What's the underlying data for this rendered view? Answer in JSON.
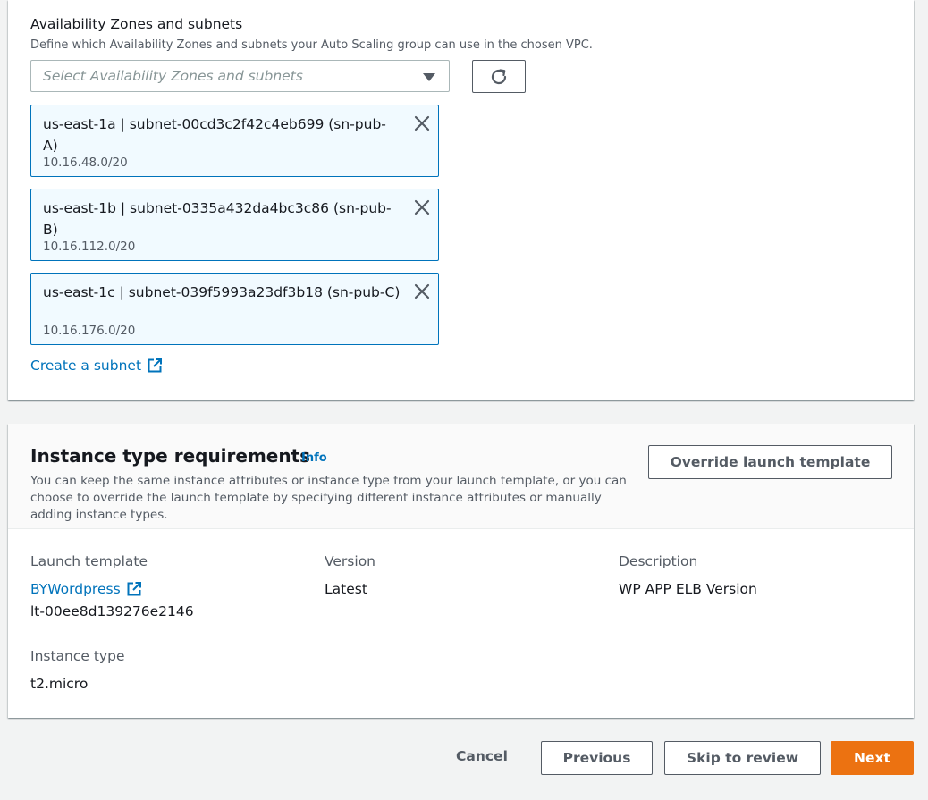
{
  "subnets_section": {
    "label": "Availability Zones and subnets",
    "description": "Define which Availability Zones and subnets your Auto Scaling group can use in the chosen VPC.",
    "select_placeholder": "Select Availability Zones and subnets",
    "tokens": [
      {
        "title": "us-east-1a | subnet-00cd3c2f42c4eb699 (sn-pub-A)",
        "cidr": "10.16.48.0/20"
      },
      {
        "title": "us-east-1b | subnet-0335a432da4bc3c86 (sn-pub-B)",
        "cidr": "10.16.112.0/20"
      },
      {
        "title": "us-east-1c | subnet-039f5993a23df3b18 (sn-pub-C)",
        "cidr": "10.16.176.0/20"
      }
    ],
    "create_subnet_link": "Create a subnet"
  },
  "instance_section": {
    "title": "Instance type requirements",
    "info": "Info",
    "description": "You can keep the same instance attributes or instance type from your launch template, or you can choose to override the launch template by specifying different instance attributes or manually adding instance types.",
    "override_button": "Override launch template",
    "launch_template_label": "Launch template",
    "launch_template_name": "BYWordpress",
    "launch_template_id": "lt-00ee8d139276e2146",
    "version_label": "Version",
    "version_value": "Latest",
    "description_label": "Description",
    "description_value": "WP APP ELB Version",
    "instance_type_label": "Instance type",
    "instance_type_value": "t2.micro"
  },
  "footer": {
    "cancel": "Cancel",
    "previous": "Previous",
    "skip": "Skip to review",
    "next": "Next"
  },
  "colors": {
    "link": "#0073bb",
    "primary": "#ec7211",
    "token_bg": "#f1faff"
  }
}
